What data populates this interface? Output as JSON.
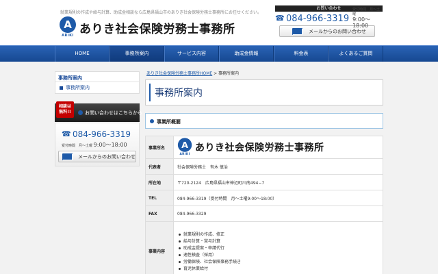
{
  "header": {
    "tagline": "就業規則の作成や給与計算、助成金相談なら広島県福山市のありき社会保険労務士事務所にお任せください。",
    "logo_letter": "A",
    "logo_sub": "ARIKI",
    "office_name": "ありき社会保険労務士事務所",
    "contact_title": "お問い合わせ",
    "phone": "084-966-3319",
    "hours_label": "受付時間　月～土曜",
    "hours_time": "9:00～18:00",
    "mail_label": "メールからのお問い合わせ"
  },
  "nav": {
    "items": [
      "HOME",
      "事務所案内",
      "サービス内容",
      "助成金情報",
      "料金表",
      "よくあるご質問"
    ],
    "active_index": 1
  },
  "sidebar": {
    "title": "事務所案内",
    "items": [
      "事務所案内"
    ],
    "banner_badge_line1": "相談は",
    "banner_badge_line2": "無料!!",
    "banner_label": "お問い合わせはこちらから",
    "phone": "084-966-3319",
    "hours_label": "受付時間　月～土曜",
    "hours_time": "9:00～18:00",
    "mail_label": "メールからのお問い合わせ"
  },
  "breadcrumb": {
    "home_link": "ありき社会保険労務士事務所HOME",
    "separator": " > ",
    "current": "事務所案内"
  },
  "main": {
    "page_title": "事務所案内",
    "section_title": "事業所概要",
    "table": {
      "office_name_label": "事業所名",
      "rows": [
        {
          "label": "代表者",
          "value": "社会保険労務士　有木 慎治"
        },
        {
          "label": "所在地",
          "value": "〒720-2124　広島県福山市神辺町川南494−7"
        },
        {
          "label": "TEL",
          "value": "084-966-3319（受付時間　月～土曜9:00～18:00）"
        },
        {
          "label": "FAX",
          "value": "084-966-3329"
        }
      ],
      "duties_label": "事業内容",
      "duties": [
        "就業規則の作成、修正",
        "給与計算・賞与計算",
        "助成金提案・申請代行",
        "適性検査（採用）",
        "労働保険、社会保険事務手続き",
        "育児休業給付"
      ]
    }
  }
}
